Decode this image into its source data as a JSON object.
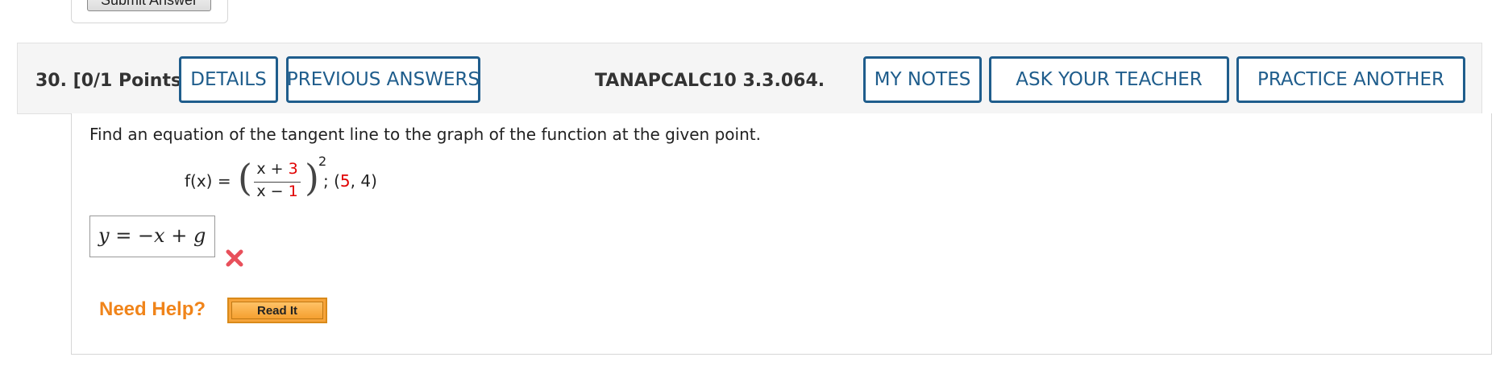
{
  "previous": {
    "submit_label": "Submit Answer"
  },
  "question": {
    "number": "30.",
    "points": "[0/1 Points]",
    "buttons": {
      "details": "DETAILS",
      "previous_answers": "PREVIOUS ANSWERS",
      "my_notes": "MY NOTES",
      "ask_teacher": "ASK YOUR TEACHER",
      "practice_another": "PRACTICE ANOTHER"
    },
    "reference": "TANAPCALC10 3.3.064.",
    "prompt": "Find an equation of the tangent line to the graph of the function at the given point.",
    "function": {
      "lhs": "f(x) =",
      "numerator_var": "x + ",
      "numerator_const": "3",
      "denominator_var": "x − ",
      "denominator_const": "1",
      "exponent": "2",
      "point_prefix": "; (",
      "point_x": "5",
      "point_sep": ", 4)"
    },
    "answer_value": "y = −x + g",
    "answer_status_icon": "x-mark-icon",
    "help": {
      "label": "Need Help?",
      "read_it": "Read It"
    }
  },
  "colors": {
    "button_border": "#1f5d8c",
    "header_bg": "#f5f5f5",
    "highlight_red": "#e00000",
    "help_orange": "#f0841a",
    "incorrect_mark": "#e8505b"
  }
}
